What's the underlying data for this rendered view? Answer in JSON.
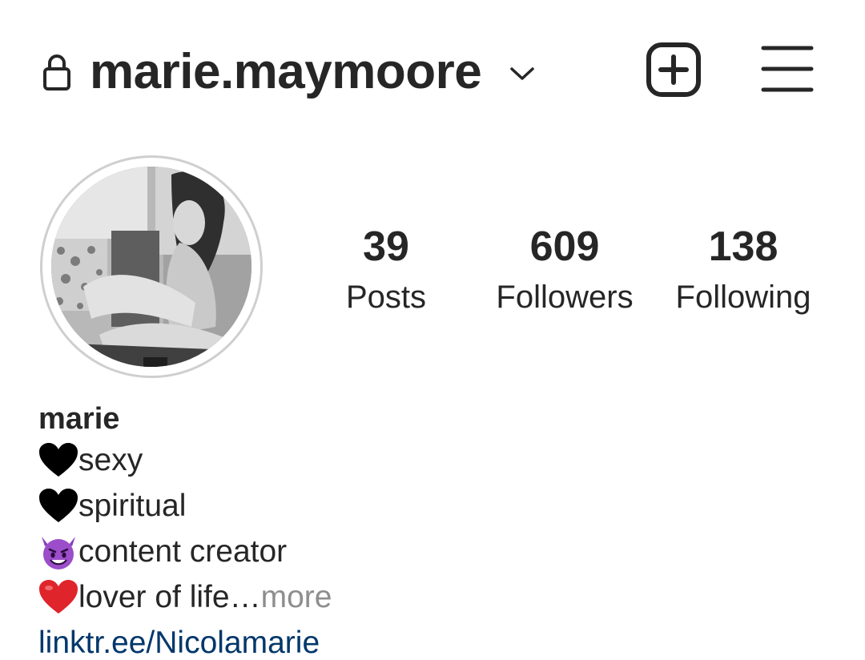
{
  "header": {
    "username": "marie.maymoore",
    "icons": [
      "lock-icon",
      "chevron-down-icon",
      "new-post-icon",
      "menu-icon"
    ]
  },
  "profile": {
    "avatar_alt": "profile-photo"
  },
  "stats": {
    "posts": {
      "count": "39",
      "label": "Posts"
    },
    "followers": {
      "count": "609",
      "label": "Followers"
    },
    "following": {
      "count": "138",
      "label": "Following"
    }
  },
  "bio": {
    "name": "marie",
    "lines": [
      {
        "emoji": "black-heart-icon",
        "text": "sexy"
      },
      {
        "emoji": "black-heart-icon",
        "text": "spiritual"
      },
      {
        "emoji": "smiling-devil-icon",
        "text": "content creator"
      },
      {
        "emoji": "red-heart-icon",
        "text": "lover of life…"
      }
    ],
    "more_label": " more",
    "link": "linktr.ee/Nicolamarie"
  }
}
